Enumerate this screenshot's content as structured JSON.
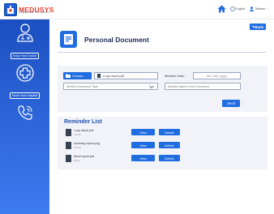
{
  "header": {
    "logo_text": "MEDUSYS",
    "logo_subtitle": "a digital health record system",
    "language": "English",
    "user": "Makeen"
  },
  "sidebar": {
    "items": [
      {
        "label": "Know Your Doctor",
        "icon": "doctor-icon"
      },
      {
        "label": "Know Your Hospital",
        "icon": "medical-cross-icon"
      },
      {
        "label": "",
        "icon": "phone-icon"
      }
    ]
  },
  "page": {
    "title": "Personal Document",
    "back_label": "Back"
  },
  "upload_form": {
    "choose_label": "Choose...",
    "file_name": "x-ray report.pdf",
    "date_label": "Mention Date :",
    "date_placeholder": "dd / mm / yyyy",
    "document_type_placeholder": "Mention Document Type",
    "document_name_placeholder": "Mention Name of the Document",
    "send_label": "Send"
  },
  "reminder": {
    "title": "Reminder List",
    "items": [
      {
        "name": "x-ray report.pdf",
        "size": "122 kb",
        "view_label": "View",
        "delete_label": "Delete"
      },
      {
        "name": "scanning report.png",
        "size": "132 kb",
        "view_label": "View",
        "delete_label": "Delete"
      },
      {
        "name": "blood report.pdf",
        "size": "83 kb",
        "view_label": "View",
        "delete_label": "Delete"
      }
    ]
  },
  "colors": {
    "primary": "#1f6de0",
    "sidebar_top": "#1c4fc1",
    "sidebar_bottom": "#3d7bf0",
    "logo_red": "#e8412c",
    "card_bg": "#f1f3f8"
  }
}
